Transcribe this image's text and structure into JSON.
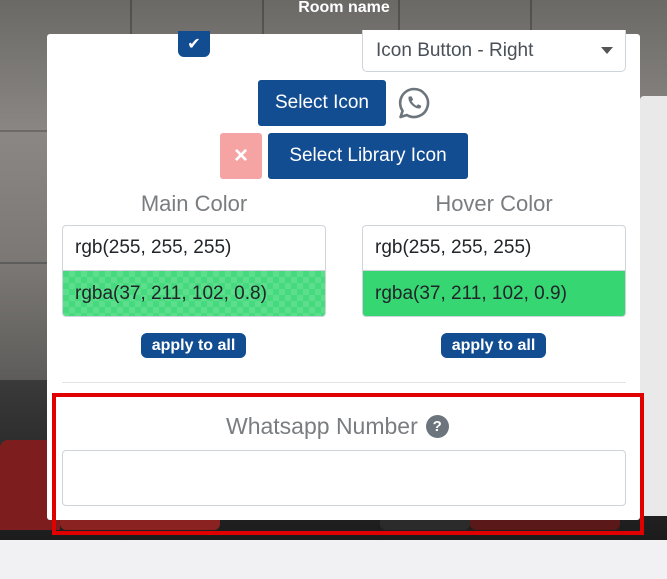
{
  "header": {
    "room_name": "Room name"
  },
  "icon_settings": {
    "checkbox_checked": true,
    "position_select": {
      "value": "Icon Button - Right"
    },
    "select_icon_label": "Select Icon",
    "select_library_icon_label": "Select Library Icon",
    "remove_icon_symbol": "×",
    "current_icon": "whatsapp-icon"
  },
  "colors": {
    "main": {
      "label": "Main Color",
      "rgb_value": "rgb(255, 255, 255)",
      "swatch_value": "rgba(37, 211, 102, 0.8)",
      "apply_label": "apply to all"
    },
    "hover": {
      "label": "Hover Color",
      "rgb_value": "rgb(255, 255, 255)",
      "swatch_value": "rgba(37, 211, 102, 0.9)",
      "apply_label": "apply to all"
    }
  },
  "whatsapp": {
    "label": "Whatsapp Number",
    "help_symbol": "?",
    "value": ""
  },
  "theme": {
    "primary": "#124d92",
    "whatsapp_green": "#25d366",
    "highlight": "#e00000",
    "remove_button": "#f5a3a3"
  }
}
